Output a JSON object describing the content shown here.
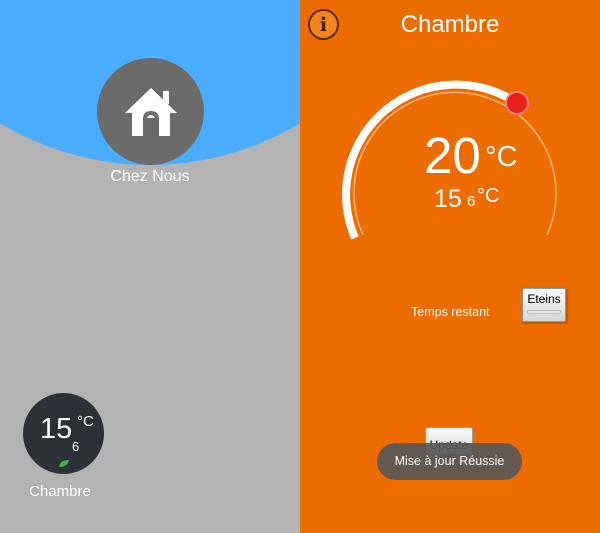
{
  "left_panel": {
    "home": {
      "label": "Chez Nous",
      "icon": "home-icon"
    },
    "room": {
      "temp_int": "15",
      "temp_unit": "°C",
      "temp_decimal": "6",
      "label": "Chambre",
      "eco_icon": "leaf-icon"
    },
    "colors": {
      "sky": "#4aadff",
      "ground": "#b3b3b3",
      "home_circle": "#6b6b6b",
      "room_circle": "#2c3137",
      "leaf": "#4caf50"
    }
  },
  "right_panel": {
    "info_icon": "i",
    "title": "Chambre",
    "target_temp": "20",
    "target_unit": "°C",
    "current_int": "15",
    "current_decimal": "6",
    "current_unit": "°C",
    "remaining_label": "Temps restant",
    "off_button": "Eteins",
    "update_button": "Update",
    "toast": "Mise à jour Réussie",
    "colors": {
      "background": "#ec6c00",
      "dial_handle": "#e8201a"
    }
  }
}
